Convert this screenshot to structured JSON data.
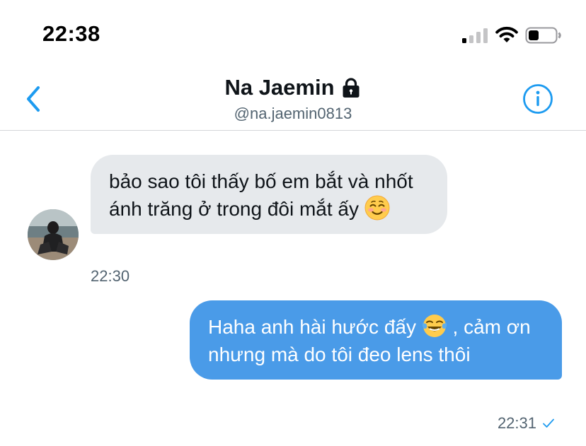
{
  "status_bar": {
    "time": "22:38"
  },
  "header": {
    "name": "Na Jaemin",
    "handle": "@na.jaemin0813"
  },
  "messages": [
    {
      "direction": "incoming",
      "text": "bảo sao tôi thấy bố em bắt và nhốt ánh trăng ở trong đôi mắt ấy",
      "emoji": "smiling-face-icon",
      "time": "22:30"
    },
    {
      "direction": "outgoing",
      "text_before": "Haha anh hài hước đấy",
      "emoji": "tears-of-joy-icon",
      "text_after": ", cảm ơn nhưng mà do tôi đeo lens thôi",
      "time": "22:31"
    }
  ],
  "colors": {
    "accent": "#1d9bf0",
    "outgoing_bubble": "#4a9be8",
    "incoming_bubble": "#e6e9ec",
    "muted_text": "#536471"
  }
}
